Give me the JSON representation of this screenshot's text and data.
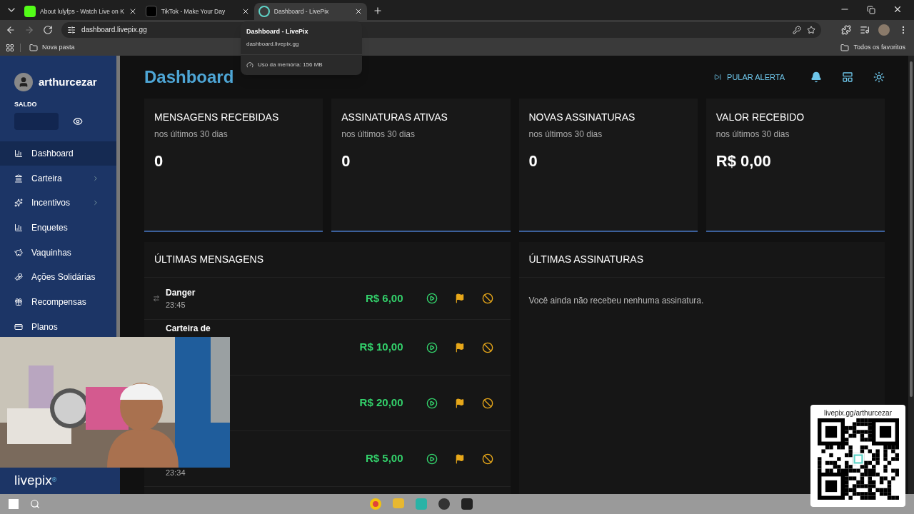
{
  "browser": {
    "tabs": [
      {
        "title": "About lulyfps - Watch Live on K",
        "kind": "kick",
        "selected": false
      },
      {
        "title": "TikTok - Make Your Day",
        "kind": "tiktok",
        "selected": false
      },
      {
        "title": "Dashboard - LivePix",
        "kind": "livepix",
        "selected": true
      }
    ],
    "address": "dashboard.livepix.gg",
    "bookmarks": [
      "Nova pasta"
    ],
    "all_bookmarks": "Todos os favoritos",
    "tab_preview": {
      "title": "Dashboard - LivePix",
      "url": "dashboard.livepix.gg",
      "memory": "Uso da memória: 156 MB"
    }
  },
  "sidebar": {
    "user": "arthurcezar",
    "balance_label": "SALDO",
    "items": [
      {
        "label": "Dashboard",
        "selected": true,
        "expandable": false
      },
      {
        "label": "Carteira",
        "selected": false,
        "expandable": true
      },
      {
        "label": "Incentivos",
        "selected": false,
        "expandable": true
      },
      {
        "label": "Enquetes",
        "selected": false,
        "expandable": false
      },
      {
        "label": "Vaquinhas",
        "selected": false,
        "expandable": false
      },
      {
        "label": "Ações Solidárias",
        "selected": false,
        "expandable": false
      },
      {
        "label": "Recompensas",
        "selected": false,
        "expandable": false
      },
      {
        "label": "Planos",
        "selected": false,
        "expandable": false
      }
    ],
    "logo": "livepix",
    "logo_mark": "®"
  },
  "header": {
    "title": "Dashboard",
    "skip_alert": "PULAR ALERTA"
  },
  "stats": [
    {
      "title": "MENSAGENS RECEBIDAS",
      "subtitle": "nos últimos 30 dias",
      "value": "0"
    },
    {
      "title": "ASSINATURAS ATIVAS",
      "subtitle": "nos últimos 30 dias",
      "value": "0"
    },
    {
      "title": "NOVAS ASSINATURAS",
      "subtitle": "nos últimos 30 dias",
      "value": "0"
    },
    {
      "title": "VALOR RECEBIDO",
      "subtitle": "nos últimos 30 dias",
      "value": "R$ 0,00"
    }
  ],
  "messages": {
    "title": "ÚLTIMAS MENSAGENS",
    "rows": [
      {
        "name": "Danger",
        "time": "23:45",
        "amount": "R$ 6,00",
        "transfer": true
      },
      {
        "name": "Carteira de",
        "amount": "R$ 10,00",
        "transfer": false
      },
      {
        "amount": "R$ 20,00",
        "transfer": false
      },
      {
        "time": "23:34",
        "amount": "R$ 5,00",
        "transfer": false
      }
    ]
  },
  "subscriptions": {
    "title": "ÚLTIMAS ASSINATURAS",
    "empty": "Você ainda não recebeu nenhuma assinatura."
  },
  "overlay": {
    "qr_url": "livepix.gg/arthurcezar"
  }
}
